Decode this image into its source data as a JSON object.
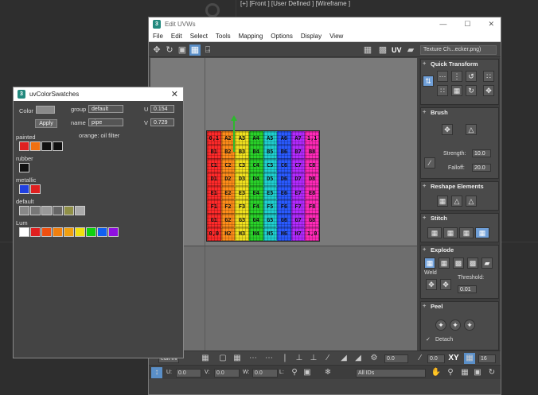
{
  "viewport": {
    "label": "[+] [Front ] [User Defined ] [Wireframe ]"
  },
  "uvw": {
    "title": "Edit UVWs",
    "menu": [
      "File",
      "Edit",
      "Select",
      "Tools",
      "Mapping",
      "Options",
      "Display",
      "View"
    ],
    "uv_label": "UV",
    "texture_select": "Texture Ch...ecker.png)",
    "checker": [
      [
        "0,1",
        "A2",
        "A3",
        "A4",
        "A5",
        "A6",
        "A7",
        "1,1"
      ],
      [
        "B1",
        "B2",
        "B3",
        "B4",
        "B5",
        "B6",
        "B7",
        "B8"
      ],
      [
        "C1",
        "C2",
        "C3",
        "C4",
        "C5",
        "C6",
        "C7",
        "C8"
      ],
      [
        "D1",
        "D2",
        "D3",
        "D4",
        "D5",
        "D6",
        "D7",
        "D8"
      ],
      [
        "E1",
        "E2",
        "E3",
        "E4",
        "E5",
        "E6",
        "E7",
        "E8"
      ],
      [
        "F1",
        "F2",
        "F3",
        "F4",
        "F5",
        "F6",
        "F7",
        "F8"
      ],
      [
        "G1",
        "G2",
        "G3",
        "G4",
        "G5",
        "G6",
        "G7",
        "G8"
      ],
      [
        "0,0",
        "H2",
        "H3",
        "H4",
        "H5",
        "H6",
        "H7",
        "1,0"
      ]
    ],
    "checker_colors": [
      "#ff2a2a",
      "#ff8c1a",
      "#f0e020",
      "#2ad22a",
      "#20d0d0",
      "#2a5aff",
      "#b22aff",
      "#ff2ab8"
    ],
    "panel": {
      "quick_transform": "Quick Transform",
      "brush": "Brush",
      "strength_label": "Strength:",
      "strength_value": "10.0",
      "falloff_label": "Falloff:",
      "falloff_value": "20.0",
      "reshape": "Reshape Elements",
      "stitch": "Stitch",
      "explode": "Explode",
      "weld": "Weld",
      "threshold_label": "Threshold:",
      "threshold_value": "0.01",
      "peel": "Peel",
      "detach": "Detach"
    },
    "bottombar": {
      "mode": "edit IN",
      "value1": "0.0",
      "value2": "0.0",
      "xy": "XY",
      "num": "16"
    },
    "statusbar": {
      "u_label": "U:",
      "u_value": "0.0",
      "v_label": "V:",
      "v_value": "0.0",
      "w_label": "W:",
      "w_value": "0.0",
      "l_label": "L:",
      "ids": "All IDs"
    }
  },
  "swatches": {
    "title": "uvColorSwatches",
    "color_label": "Color",
    "apply": "Apply",
    "group_label": "group",
    "group_value": "default",
    "name_label": "name",
    "name_value": "pipe",
    "u_label": "U",
    "u_value": "0.154",
    "v_label": "V",
    "v_value": "0.729",
    "note": "orange: oil filter",
    "groups": [
      {
        "label": "painted",
        "colors": [
          "#e02020",
          "#f07010",
          "#111111",
          "#111111"
        ]
      },
      {
        "label": "rubber",
        "colors": [
          "#111111"
        ]
      },
      {
        "label": "metallic",
        "colors": [
          "#2040e0",
          "#e02020"
        ]
      },
      {
        "label": "default",
        "colors": [
          "#888888",
          "#777777",
          "#999999",
          "#666666",
          "#909048",
          "#aaaaaa"
        ]
      },
      {
        "label": "Lum",
        "colors": [
          "#ffffff",
          "#e02020",
          "#f05010",
          "#f08010",
          "#f0a010",
          "#f0e010",
          "#10d010",
          "#1060f0",
          "#9010e0"
        ]
      }
    ]
  }
}
